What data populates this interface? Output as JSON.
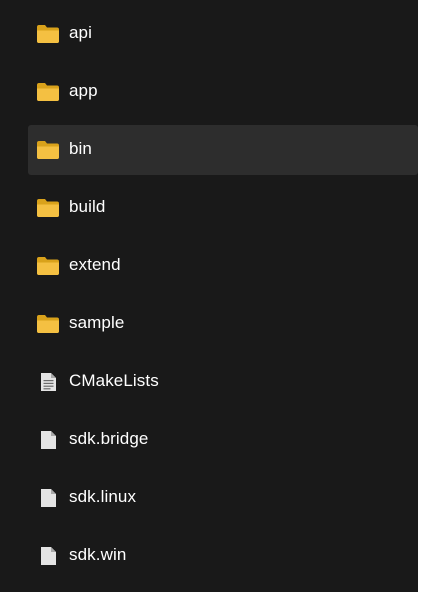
{
  "file_list": {
    "items": [
      {
        "name": "api",
        "type": "folder",
        "icon": "folder-icon",
        "selected": false
      },
      {
        "name": "app",
        "type": "folder",
        "icon": "folder-icon",
        "selected": false
      },
      {
        "name": "bin",
        "type": "folder",
        "icon": "folder-icon",
        "selected": true
      },
      {
        "name": "build",
        "type": "folder",
        "icon": "folder-icon",
        "selected": false
      },
      {
        "name": "extend",
        "type": "folder",
        "icon": "folder-icon",
        "selected": false
      },
      {
        "name": "sample",
        "type": "folder",
        "icon": "folder-icon",
        "selected": false
      },
      {
        "name": "CMakeLists",
        "type": "file",
        "icon": "text-file-icon",
        "selected": false
      },
      {
        "name": "sdk.bridge",
        "type": "file",
        "icon": "file-icon",
        "selected": false
      },
      {
        "name": "sdk.linux",
        "type": "file",
        "icon": "file-icon",
        "selected": false
      },
      {
        "name": "sdk.win",
        "type": "file",
        "icon": "file-icon",
        "selected": false
      }
    ]
  },
  "colors": {
    "background": "#191919",
    "selected_row": "#2d2d2d",
    "text": "#ffffff",
    "folder": "#f4c042",
    "file": "#e4e4e4"
  }
}
